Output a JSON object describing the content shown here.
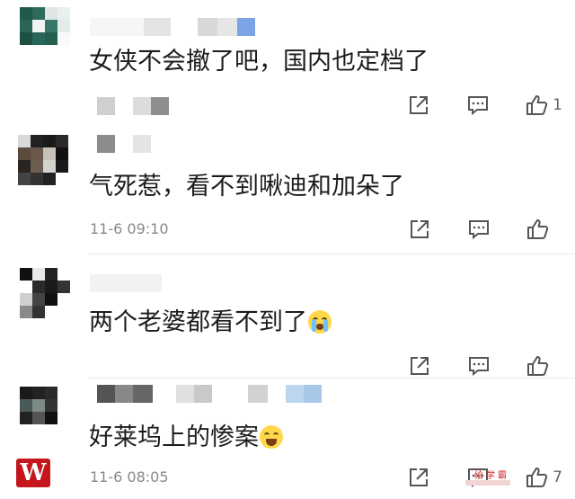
{
  "colors": {
    "text": "#1c1c1c",
    "meta": "#888888",
    "icon": "#555555",
    "logo": "#c4161c"
  },
  "comments": [
    {
      "text": "女侠不会撤了吧，国内也定档了",
      "time": "",
      "like_count": "1"
    },
    {
      "text": "气死惹，看不到啾迪和加朵了",
      "time": "11-6 09:10",
      "like_count": ""
    },
    {
      "text": "两个老婆都看不到了",
      "emoji": "loudly-crying-face",
      "time": "",
      "like_count": ""
    },
    {
      "text": "好莱坞上的惨案",
      "emoji": "laughing-tears-face",
      "time": "11-6 08:05",
      "like_count": "7"
    }
  ],
  "icons": {
    "share": "share-icon",
    "reply": "comment-icon",
    "like": "thumbs-up-icon"
  },
  "logo": {
    "letter": "W"
  },
  "watermark": {
    "text": "绘学霸"
  }
}
